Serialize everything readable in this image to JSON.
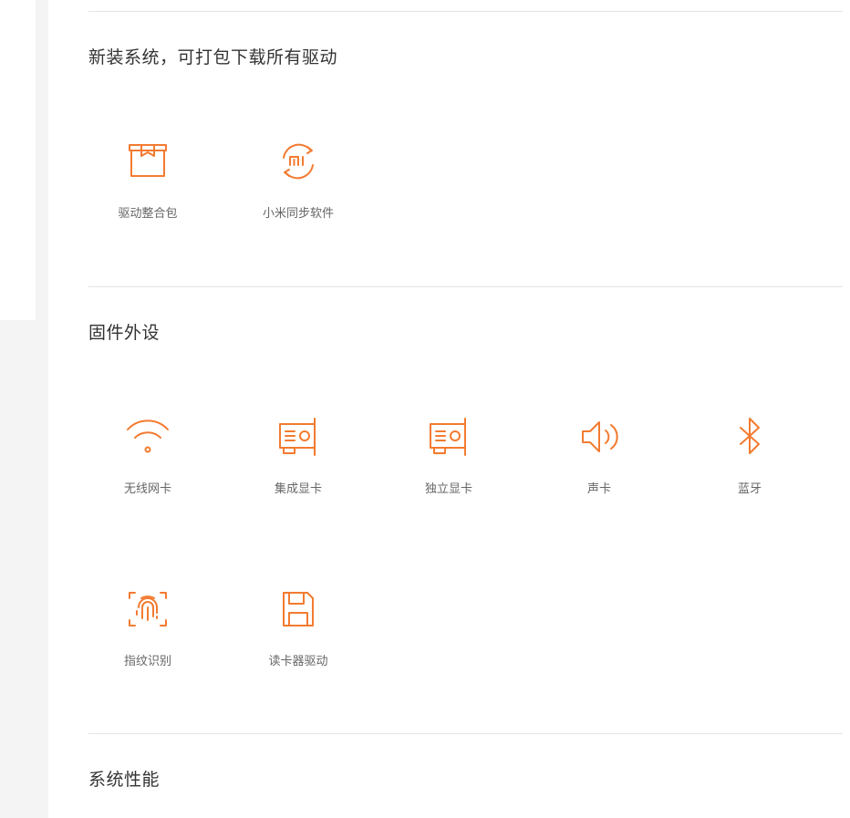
{
  "colors": {
    "accent": "#f37b30",
    "divider": "#e4e4e4",
    "title": "#333333",
    "label": "#666666"
  },
  "sections": [
    {
      "title": "新装系统，可打包下载所有驱动",
      "items": [
        {
          "label": "驱动整合包",
          "icon": "package-icon"
        },
        {
          "label": "小米同步软件",
          "icon": "mi-sync-icon"
        }
      ]
    },
    {
      "title": "固件外设",
      "items": [
        {
          "label": "无线网卡",
          "icon": "wifi-icon"
        },
        {
          "label": "集成显卡",
          "icon": "graphics-card-icon"
        },
        {
          "label": "独立显卡",
          "icon": "graphics-card-icon"
        },
        {
          "label": "声卡",
          "icon": "speaker-icon"
        },
        {
          "label": "蓝牙",
          "icon": "bluetooth-icon"
        },
        {
          "label": "指纹识别",
          "icon": "fingerprint-icon"
        },
        {
          "label": "读卡器驱动",
          "icon": "floppy-disk-icon"
        }
      ]
    },
    {
      "title": "系统性能",
      "items": []
    }
  ]
}
